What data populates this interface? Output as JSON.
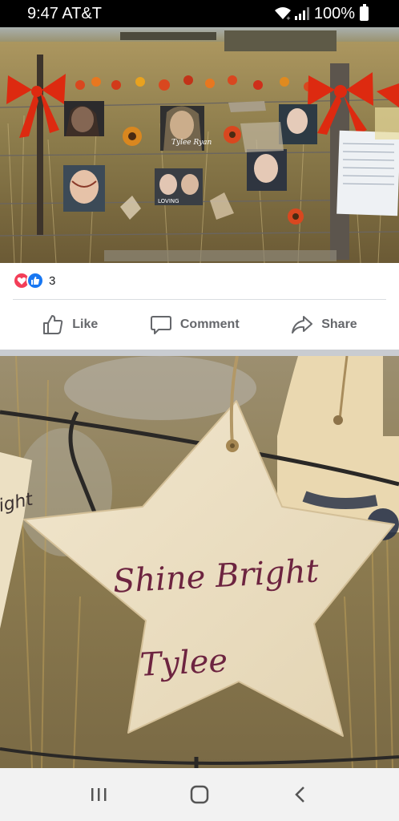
{
  "status_bar": {
    "time_carrier": "9:47 AT&T",
    "battery": "100%",
    "icons": [
      "wifi-icon",
      "signal-icon",
      "battery-icon"
    ]
  },
  "post": {
    "reactions": {
      "types": [
        "love",
        "like"
      ],
      "count": "3"
    },
    "actions": {
      "like": "Like",
      "comment": "Comment",
      "share": "Share"
    }
  },
  "photo1": {
    "sign_tags": [
      "Tylee Ryan",
      "LOVING"
    ]
  },
  "photo2": {
    "star_text_line1": "Shine Bright",
    "star_text_line2": "Tylee",
    "left_star_text": "ight"
  },
  "nav_bar": {
    "buttons": [
      "recent-apps",
      "home",
      "back"
    ]
  },
  "colors": {
    "facebook_blue": "#1877f2",
    "love_red": "#f33e58",
    "action_gray": "#65676b"
  }
}
